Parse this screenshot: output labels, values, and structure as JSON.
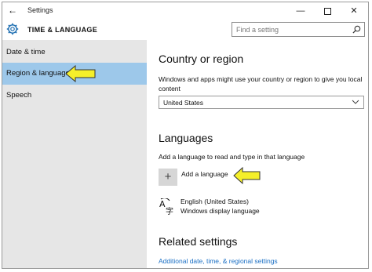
{
  "window": {
    "title": "Settings",
    "back_icon": "back-arrow-icon",
    "minimize": "—",
    "close": "✕"
  },
  "header": {
    "section_title": "TIME & LANGUAGE",
    "search_placeholder": "Find a setting"
  },
  "sidebar": {
    "items": [
      {
        "label": "Date & time",
        "selected": false
      },
      {
        "label": "Region & language",
        "selected": true
      },
      {
        "label": "Speech",
        "selected": false
      }
    ],
    "selected_color": "#9dc8ea"
  },
  "main": {
    "country_heading": "Country or region",
    "country_description": "Windows and apps might use your country or region to give you local content",
    "country_value": "United States",
    "languages_heading": "Languages",
    "languages_description": "Add a language to read and type in that language",
    "add_language_label": "Add a language",
    "add_language_icon": "+",
    "language_name": "English (United States)",
    "language_sub": "Windows display language",
    "related_heading": "Related settings",
    "related_link": "Additional date, time, & regional settings"
  },
  "annotations": {
    "arrow_color": "#f5ef2a"
  }
}
